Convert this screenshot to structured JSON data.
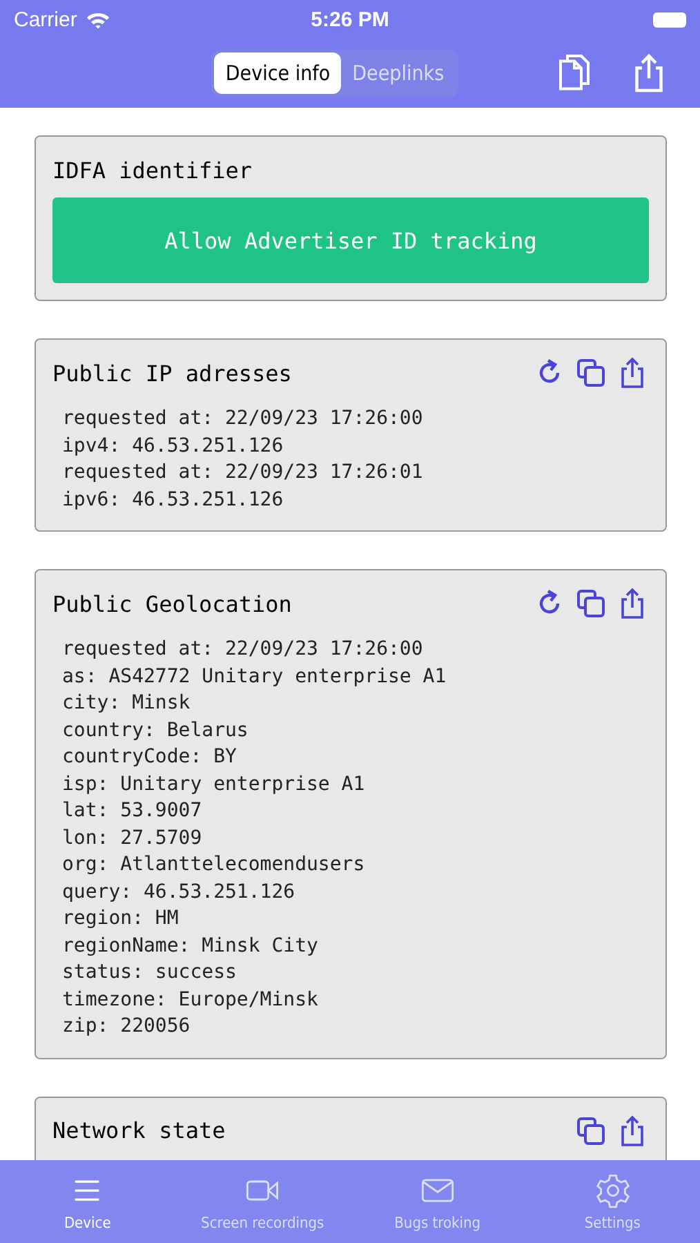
{
  "status_bar": {
    "carrier": "Carrier",
    "time": "5:26 PM"
  },
  "nav": {
    "tabs": [
      {
        "label": "Device info",
        "selected": true
      },
      {
        "label": "Deeplinks",
        "selected": false
      }
    ]
  },
  "cards": [
    {
      "kind": "button",
      "title": "IDFA identifier",
      "button": "Allow Advertiser ID tracking"
    },
    {
      "kind": "refreshable",
      "title": "Public IP adresses",
      "lines": [
        "requested at: 22/09/23 17:26:00",
        "ipv4: 46.53.251.126",
        "requested at: 22/09/23 17:26:01",
        "ipv6: 46.53.251.126"
      ]
    },
    {
      "kind": "refreshable",
      "title": "Public Geolocation",
      "lines": [
        "requested at: 22/09/23 17:26:00",
        "as: AS42772 Unitary enterprise A1",
        "city: Minsk",
        "country: Belarus",
        "countryCode: BY",
        "isp: Unitary enterprise A1",
        "lat: 53.9007",
        "lon: 27.5709",
        "org: Atlanttelecomendusers",
        "query: 46.53.251.126",
        "region: HM",
        "regionName: Minsk City",
        "status: success",
        "timezone: Europe/Minsk",
        "zip: 220056"
      ]
    },
    {
      "kind": "info",
      "title": "Network state"
    }
  ],
  "tab_bar": [
    {
      "label": "Device",
      "selected": true
    },
    {
      "label": "Screen recordings",
      "selected": false
    },
    {
      "label": "Bugs troking",
      "selected": false
    },
    {
      "label": "Settings",
      "selected": false
    }
  ]
}
